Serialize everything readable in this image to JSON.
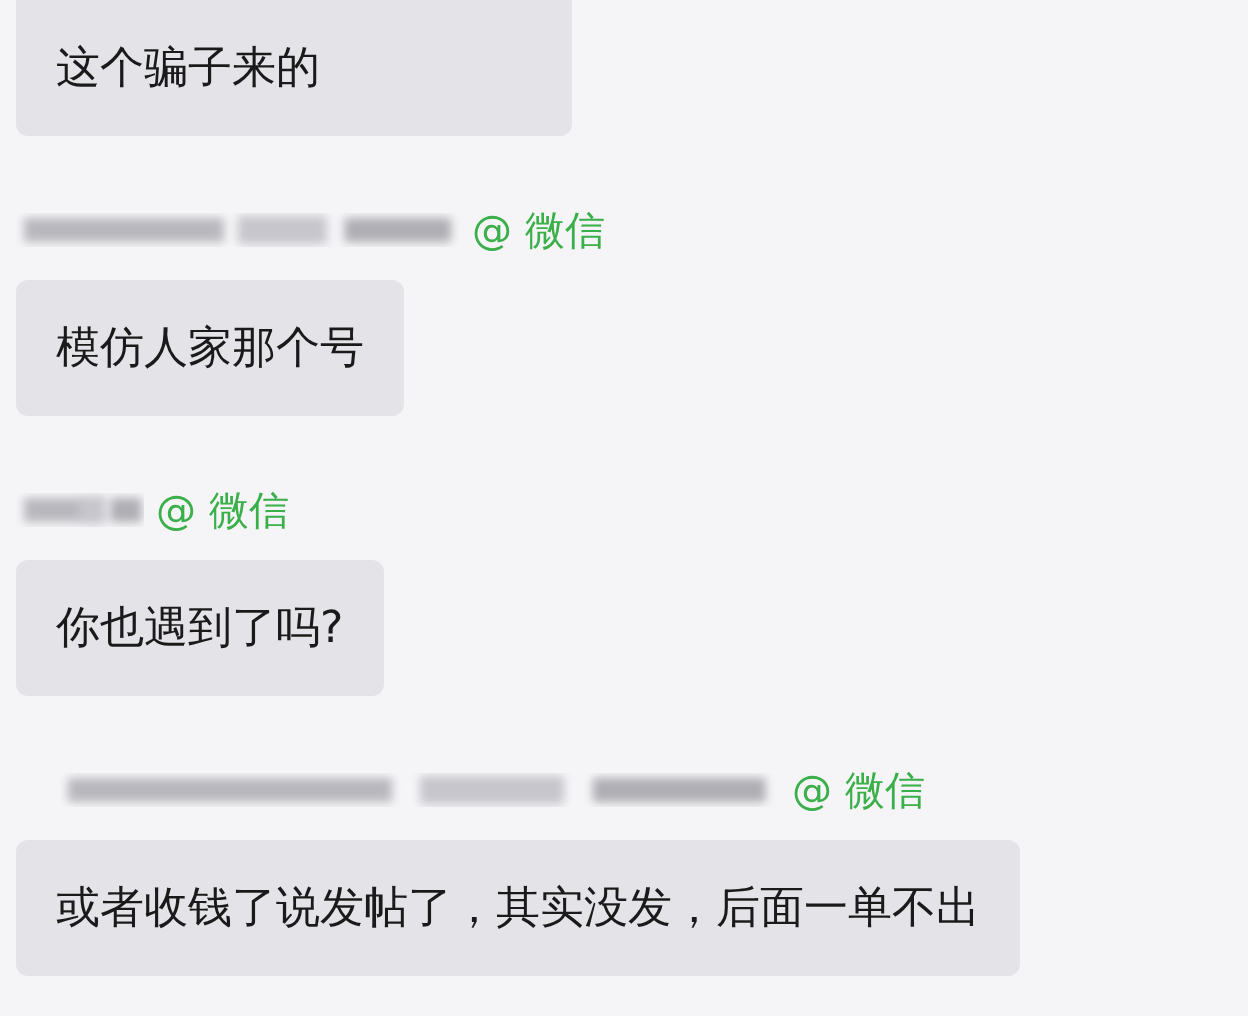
{
  "messages": [
    {
      "kind": "bubble",
      "text": "这个骗子来的"
    },
    {
      "kind": "sender",
      "source": "@ 微信"
    },
    {
      "kind": "bubble",
      "text": "模仿人家那个号"
    },
    {
      "kind": "sender",
      "source": "@ 微信"
    },
    {
      "kind": "bubble",
      "text": "你也遇到了吗?"
    },
    {
      "kind": "sender",
      "source": "@ 微信"
    },
    {
      "kind": "bubble",
      "text": "或者收钱了说发帖了，其实没发，后面一单不出"
    }
  ]
}
